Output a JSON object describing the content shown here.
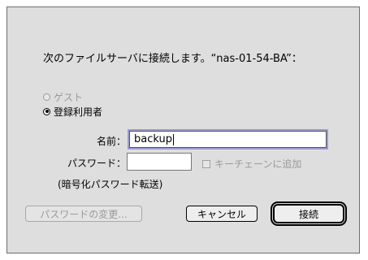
{
  "message": "次のファイルサーバに接続します。“nas-01-54-BA”：",
  "radios": [
    {
      "label": "ゲスト",
      "checked": false,
      "disabled": true
    },
    {
      "label": "登録利用者",
      "checked": true,
      "disabled": false
    }
  ],
  "name_label": "名前：",
  "name_value": "backup",
  "password_label": "パスワード：",
  "password_value": "",
  "keychain_label": "キーチェーンに追加",
  "encryption_note": "(暗号化パスワード転送)",
  "buttons": {
    "change_password": "パスワードの変更...",
    "cancel": "キャンセル",
    "connect": "接続"
  }
}
